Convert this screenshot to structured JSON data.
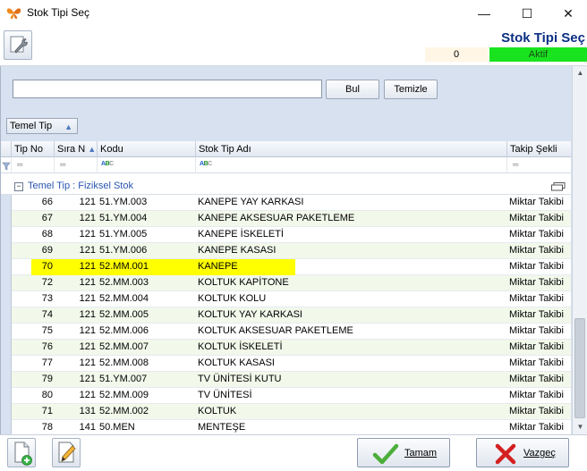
{
  "window": {
    "title": "Stok Tipi Seç",
    "minimize": "—",
    "maximize": "☐",
    "close": "✕"
  },
  "header": {
    "title": "Stok Tipi Seç",
    "counter": "0",
    "status": "Aktif",
    "status_color": "#19e31f"
  },
  "search": {
    "value": "",
    "bul_label": "Bul",
    "temizle_label": "Temizle"
  },
  "grouping": {
    "chip_label": "Temel Tip",
    "group_label": "Temel Tip : Fiziksel Stok"
  },
  "columns": {
    "tip_no": "Tip No",
    "sira_no": "Sıra N",
    "kodu": "Kodu",
    "stok_tip_adi": "Stok Tip Adı",
    "takip_sekli": "Takip Şekli"
  },
  "rows": [
    {
      "tip_no": "66",
      "sira": "121",
      "kodu": "51.YM.003",
      "ad": "KANEPE YAY KARKASI",
      "takip": "Miktar Takibi"
    },
    {
      "tip_no": "67",
      "sira": "121",
      "kodu": "51.YM.004",
      "ad": "KANEPE AKSESUAR PAKETLEME",
      "takip": "Miktar Takibi"
    },
    {
      "tip_no": "68",
      "sira": "121",
      "kodu": "51.YM.005",
      "ad": "KANEPE İSKELETİ",
      "takip": "Miktar Takibi"
    },
    {
      "tip_no": "69",
      "sira": "121",
      "kodu": "51.YM.006",
      "ad": "KANEPE KASASI",
      "takip": "Miktar Takibi"
    },
    {
      "tip_no": "70",
      "sira": "121",
      "kodu": "52.MM.001",
      "ad": "KANEPE",
      "takip": "Miktar Takibi"
    },
    {
      "tip_no": "72",
      "sira": "121",
      "kodu": "52.MM.003",
      "ad": "KOLTUK KAPİTONE",
      "takip": "Miktar Takibi"
    },
    {
      "tip_no": "73",
      "sira": "121",
      "kodu": "52.MM.004",
      "ad": "KOLTUK KOLU",
      "takip": "Miktar Takibi"
    },
    {
      "tip_no": "74",
      "sira": "121",
      "kodu": "52.MM.005",
      "ad": "KOLTUK YAY KARKASI",
      "takip": "Miktar Takibi"
    },
    {
      "tip_no": "75",
      "sira": "121",
      "kodu": "52.MM.006",
      "ad": "KOLTUK AKSESUAR PAKETLEME",
      "takip": "Miktar Takibi"
    },
    {
      "tip_no": "76",
      "sira": "121",
      "kodu": "52.MM.007",
      "ad": "KOLTUK İSKELETİ",
      "takip": "Miktar Takibi"
    },
    {
      "tip_no": "77",
      "sira": "121",
      "kodu": "52.MM.008",
      "ad": "KOLTUK KASASI",
      "takip": "Miktar Takibi"
    },
    {
      "tip_no": "79",
      "sira": "121",
      "kodu": "51.YM.007",
      "ad": "TV ÜNİTESİ KUTU",
      "takip": "Miktar Takibi"
    },
    {
      "tip_no": "80",
      "sira": "121",
      "kodu": "52.MM.009",
      "ad": "TV ÜNİTESİ",
      "takip": "Miktar Takibi"
    },
    {
      "tip_no": "71",
      "sira": "131",
      "kodu": "52.MM.002",
      "ad": "KOLTUK",
      "takip": "Miktar Takibi"
    },
    {
      "tip_no": "78",
      "sira": "141",
      "kodu": "50.MEN",
      "ad": "MENTEŞE",
      "takip": "Miktar Takibi"
    }
  ],
  "selected_tip_no": "70",
  "footer": {
    "tamam_label": "Tamam",
    "vazgec_label": "Vazgeç"
  },
  "icons": {
    "app": "butterfly-icon",
    "tools": "wrench-icon",
    "new": "new-document-icon",
    "edit": "pencil-icon",
    "ok": "checkmark-icon",
    "cancel": "red-x-icon"
  }
}
